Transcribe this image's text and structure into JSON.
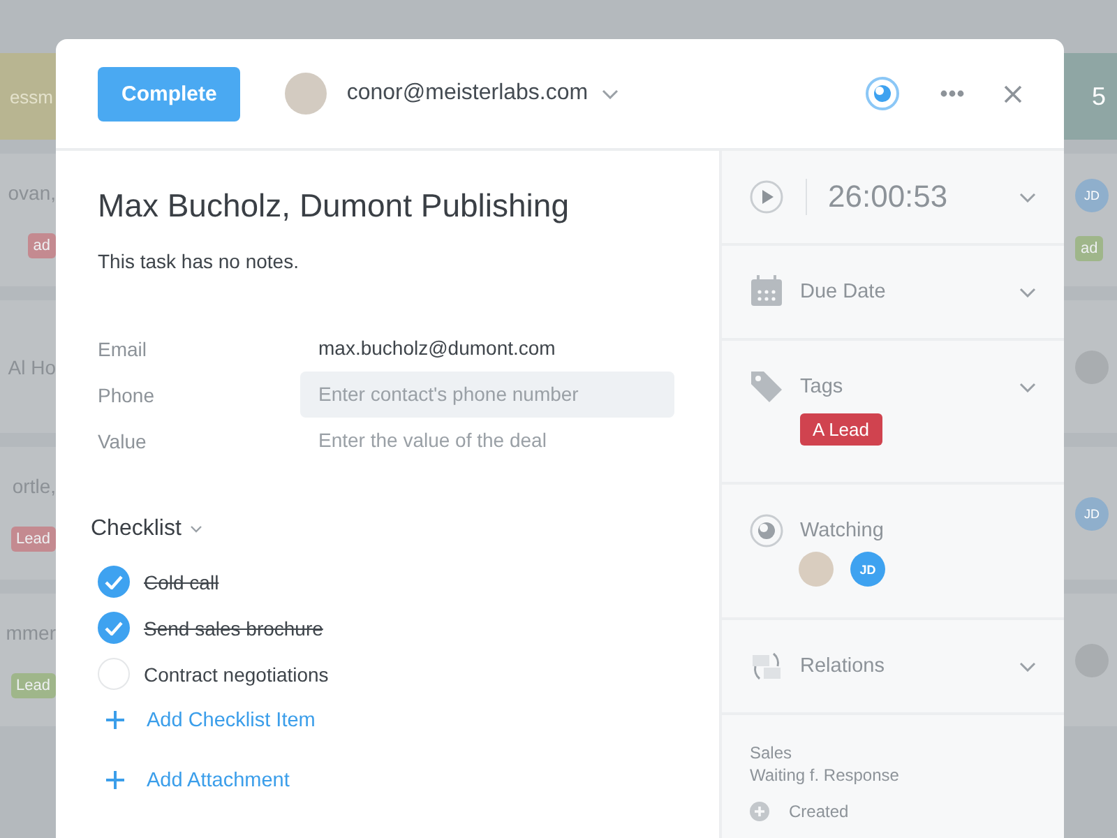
{
  "background_board": {
    "left_column": {
      "header": "essm",
      "cards": [
        {
          "title": "ovan,",
          "tag": {
            "label": "ad",
            "color": "#c48a90"
          }
        },
        {
          "title": "Al Ho"
        },
        {
          "title": "ortle,",
          "tag": {
            "label": "Lead",
            "color": "#c48a90"
          }
        },
        {
          "title": "mmer",
          "tag": {
            "label": "Lead",
            "color": "#9fb68a"
          }
        }
      ]
    },
    "right_column": {
      "header": "5",
      "cards": [
        {
          "avatar": {
            "kind": "initials",
            "initials": "JD"
          },
          "tag": {
            "label": "ad",
            "color": "#9fb68a"
          }
        },
        {
          "avatar": {
            "kind": "photo"
          }
        },
        {
          "avatar": {
            "kind": "initials",
            "initials": "JD"
          }
        },
        {
          "avatar": {
            "kind": "photo"
          }
        }
      ]
    }
  },
  "task_dialog": {
    "header": {
      "complete_button": "Complete",
      "assignee": {
        "email": "conor@meisterlabs.com",
        "avatar": {
          "kind": "photo"
        }
      },
      "watching": true
    },
    "title": "Max Bucholz, Dumont Publishing",
    "notes": "This task has no notes.",
    "fields": [
      {
        "label": "Email",
        "value": "max.bucholz@dumont.com",
        "focused": false
      },
      {
        "label": "Phone",
        "placeholder": "Enter contact's phone number",
        "focused": true
      },
      {
        "label": "Value",
        "placeholder": "Enter the value of the deal",
        "focused": false
      }
    ],
    "checklist": {
      "title": "Checklist",
      "items": [
        {
          "label": "Cold call",
          "checked": true
        },
        {
          "label": "Send sales brochure",
          "checked": true
        },
        {
          "label": "Contract negotiations",
          "checked": false
        }
      ],
      "add_item": "Add Checklist Item"
    },
    "add_attachment": "Add Attachment",
    "sidebar": {
      "timer": {
        "time": "26:00:53",
        "running": false
      },
      "sections": [
        {
          "kind": "due_date",
          "label": "Due Date",
          "collapsible": true
        },
        {
          "kind": "tags",
          "label": "Tags",
          "collapsible": true,
          "tags": [
            {
              "label": "A Lead",
              "color": "#d0434f"
            }
          ]
        },
        {
          "kind": "watching",
          "label": "Watching",
          "collapsible": false,
          "watchers": [
            {
              "kind": "photo"
            },
            {
              "kind": "initials",
              "initials": "JD"
            }
          ]
        },
        {
          "kind": "relations",
          "label": "Relations",
          "collapsible": true
        }
      ],
      "footer": {
        "project": "Sales",
        "section": "Waiting f. Response",
        "activity": [
          {
            "label": "Created"
          }
        ]
      }
    }
  }
}
